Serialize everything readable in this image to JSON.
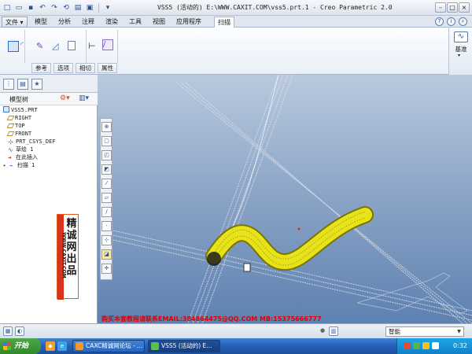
{
  "titlebar": {
    "title": "VSS5 (活动的) E:\\WWW.CAXIT.COM\\vss5.prt.1 - Creo Parametric 2.0",
    "quick_access": [
      "新建",
      "打开",
      "保存",
      "撤销",
      "重做",
      "再生",
      "窗口",
      "关闭"
    ]
  },
  "menu": {
    "file_label": "文件",
    "tabs": [
      "模型",
      "分析",
      "注释",
      "渲染",
      "工具",
      "视图",
      "应用程序"
    ],
    "active_tab": "扫描"
  },
  "ribbon": {
    "subtabs": [
      "参考",
      "选项",
      "相切",
      "属性"
    ],
    "base_label": "基准"
  },
  "model_tree": {
    "title": "模型树",
    "items": [
      {
        "label": "VSS5.PRT",
        "icon": "part-icon"
      },
      {
        "label": "RIGHT",
        "icon": "datum-plane-icon"
      },
      {
        "label": "TOP",
        "icon": "datum-plane-icon"
      },
      {
        "label": "FRONT",
        "icon": "datum-plane-icon"
      },
      {
        "label": "PRT_CSYS_DEF",
        "icon": "csys-icon"
      },
      {
        "label": "草绘 1",
        "icon": "sketch-icon"
      },
      {
        "label": "在此插入",
        "icon": "insert-here-icon"
      },
      {
        "label": "扫描 1",
        "icon": "sweep-icon"
      }
    ]
  },
  "watermark": {
    "chinese": "精诚网出品",
    "url": "WWW.CAXIT.COM"
  },
  "viewport": {
    "ad_text": "购买本套教程请联系EMAIL:384864475@QQ.COM MB:15375666777",
    "colors": {
      "sweep": "#e7e21a",
      "background_top": "#b9c9de",
      "background_bottom": "#5e81b0"
    }
  },
  "statusbar": {
    "select_value": "智能"
  },
  "taskbar": {
    "start_label": "开始",
    "tasks": [
      {
        "label": "CAXC精诚网论坛 - ..."
      },
      {
        "label": "VSS5 (活动的) E..."
      }
    ],
    "clock": "0:32"
  }
}
